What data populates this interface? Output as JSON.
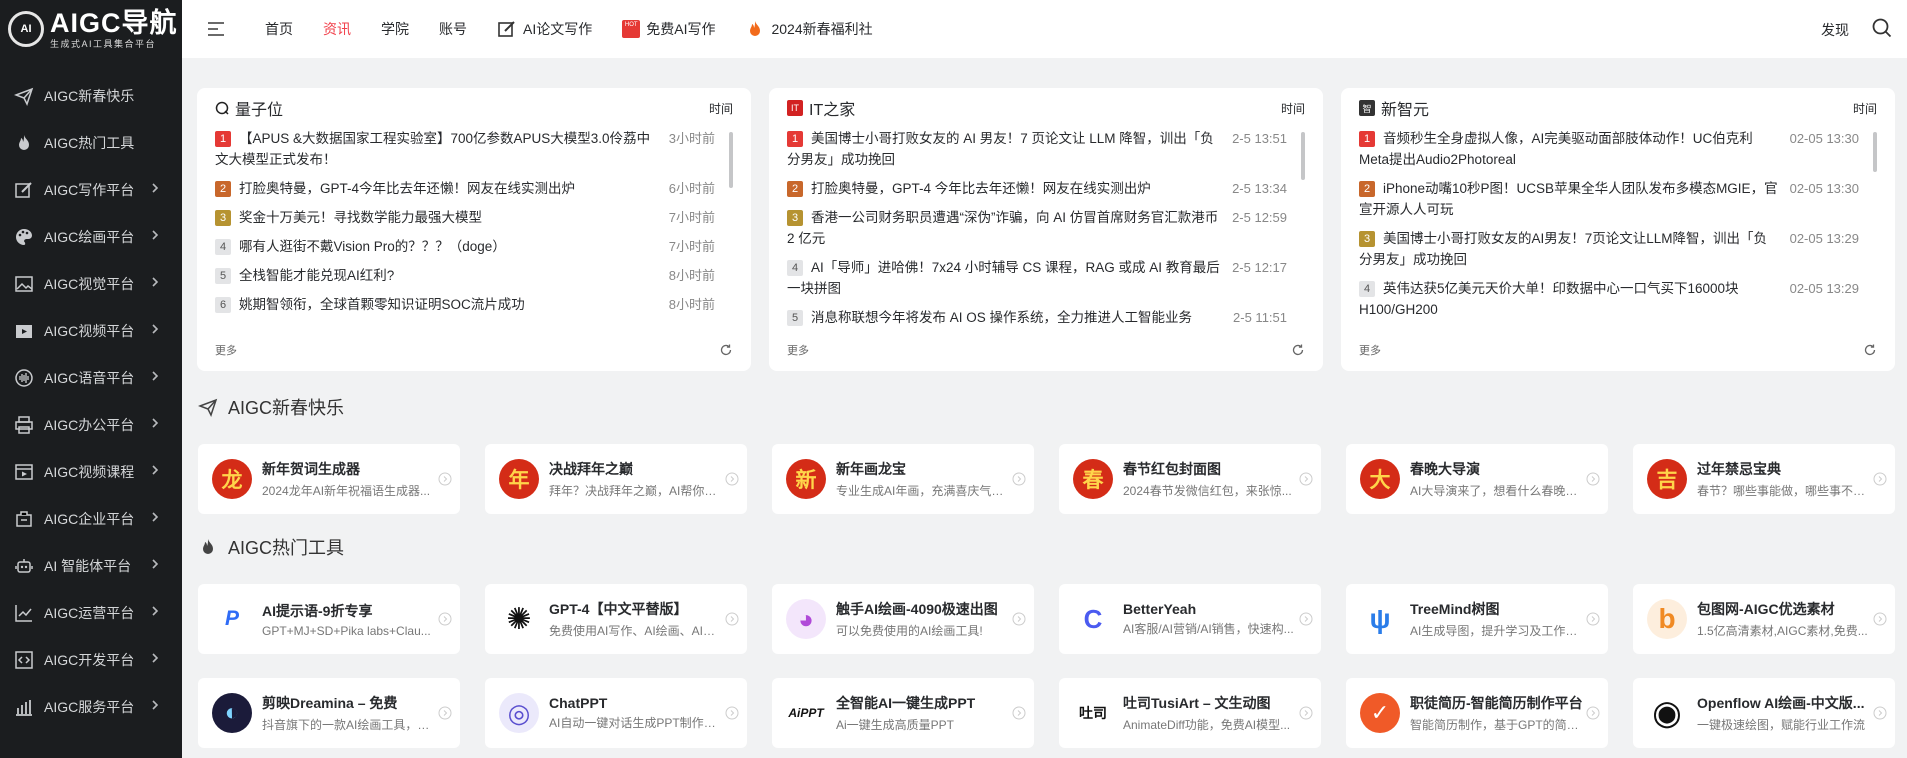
{
  "logo": {
    "title": "AIGC导航",
    "subtitle": "生成式AI工具集合平台",
    "mark": "AI"
  },
  "sidebar": {
    "items": [
      {
        "label": "AIGC新春快乐",
        "icon": "paper-plane-icon",
        "has_children": false
      },
      {
        "label": "AIGC热门工具",
        "icon": "fire-icon",
        "has_children": false
      },
      {
        "label": "AIGC写作平台",
        "icon": "pen-icon",
        "has_children": true
      },
      {
        "label": "AIGC绘画平台",
        "icon": "palette-icon",
        "has_children": true
      },
      {
        "label": "AIGC视觉平台",
        "icon": "image-icon",
        "has_children": true
      },
      {
        "label": "AIGC视频平台",
        "icon": "video-icon",
        "has_children": true
      },
      {
        "label": "AIGC语音平台",
        "icon": "waveform-icon",
        "has_children": true
      },
      {
        "label": "AIGC办公平台",
        "icon": "printer-icon",
        "has_children": true
      },
      {
        "label": "AIGC视频课程",
        "icon": "film-icon",
        "has_children": true
      },
      {
        "label": "AIGC企业平台",
        "icon": "building-icon",
        "has_children": true
      },
      {
        "label": "AI 智能体平台",
        "icon": "robot-icon",
        "has_children": true
      },
      {
        "label": "AIGC运营平台",
        "icon": "chart-line-icon",
        "has_children": true
      },
      {
        "label": "AIGC开发平台",
        "icon": "code-icon",
        "has_children": true
      },
      {
        "label": "AIGC服务平台",
        "icon": "bar-chart-icon",
        "has_children": true
      }
    ]
  },
  "topnav": {
    "items": [
      {
        "label": "首页",
        "active": false
      },
      {
        "label": "资讯",
        "active": true
      },
      {
        "label": "学院",
        "active": false
      },
      {
        "label": "账号",
        "active": false
      },
      {
        "label": "AI论文写作",
        "icon": "edit-icon",
        "active": false
      },
      {
        "label": "免费AI写作",
        "icon": "hot-icon",
        "badge": "HOT",
        "active": false
      },
      {
        "label": "2024新春福利社",
        "icon": "fire-icon",
        "active": false
      }
    ],
    "discover": "发现"
  },
  "news": [
    {
      "source": "量子位",
      "icon": "qbitai-icon",
      "icon_color": "#222222",
      "time_label": "时间",
      "more": "更多",
      "items": [
        {
          "rank": "1",
          "title": "【APUS &大数据国家工程实验室】700亿参数APUS大模型3.0伶荔中文大模型正式发布！",
          "time": "3小时前"
        },
        {
          "rank": "2",
          "title": "打脸奥特曼，GPT-4今年比去年还懒！网友在线实测出炉",
          "time": "6小时前"
        },
        {
          "rank": "3",
          "title": "奖金十万美元！寻找数学能力最强大模型",
          "time": "7小时前"
        },
        {
          "rank": "4",
          "title": "哪有人逛街不戴Vision Pro的？？？（doge）",
          "time": "7小时前"
        },
        {
          "rank": "5",
          "title": "全栈智能才能兑现AI红利?",
          "time": "8小时前"
        },
        {
          "rank": "6",
          "title": "姚期智领衔，全球首颗零知识证明SOC流片成功",
          "time": "8小时前"
        }
      ]
    },
    {
      "source": "IT之家",
      "icon": "ithome-icon",
      "icon_color": "#d22222",
      "time_label": "时间",
      "more": "更多",
      "items": [
        {
          "rank": "1",
          "title": "美国博士小哥打败女友的 AI 男友！7 页论文让 LLM 降智，训出「负分男友」成功挽回",
          "time": "2-5 13:51"
        },
        {
          "rank": "2",
          "title": "打脸奥特曼，GPT-4 今年比去年还懒！网友在线实测出炉",
          "time": "2-5 13:34"
        },
        {
          "rank": "3",
          "title": "香港一公司财务职员遭遇“深伪”诈骗，向 AI 仿冒首席财务官汇款港币 2 亿元",
          "time": "2-5 12:59"
        },
        {
          "rank": "4",
          "title": "AI「导师」进哈佛！7x24 小时辅导 CS 课程，RAG 或成 AI 教育最后一块拼图",
          "time": "2-5 12:17"
        },
        {
          "rank": "5",
          "title": "消息称联想今年将发布 AI OS 操作系统，全力推进人工智能业务",
          "time": "2-5 11:51"
        }
      ]
    },
    {
      "source": "新智元",
      "icon": "aiera-icon",
      "icon_color": "#333333",
      "time_label": "时间",
      "more": "更多",
      "items": [
        {
          "rank": "1",
          "title": "音频秒生全身虚拟人像，AI完美驱动面部肢体动作！UC伯克利Meta提出Audio2Photoreal",
          "time": "02-05 13:30"
        },
        {
          "rank": "2",
          "title": "iPhone动嘴10秒P图！UCSB苹果全华人团队发布多模态MGIE，官宣开源人人可玩",
          "time": "02-05 13:30"
        },
        {
          "rank": "3",
          "title": "美国博士小哥打败女友的AI男友！7页论文让LLM降智，训出「负分男友」成功挽回",
          "time": "02-05 13:29"
        },
        {
          "rank": "4",
          "title": "英伟达获5亿美元天价大单！印数据中心一口气买下16000块H100/GH200",
          "time": "02-05 13:29"
        }
      ]
    }
  ],
  "sections": [
    {
      "title": "AIGC新春快乐",
      "icon": "paper-plane-icon",
      "tools": [
        {
          "name": "新年贺词生成器",
          "desc": "2024龙年AI新年祝福语生成器...",
          "glyph": "龙",
          "style": "fest"
        },
        {
          "name": "决战拜年之巅",
          "desc": "拜年？决战拜年之巅，AI帮你提...",
          "glyph": "年",
          "style": "fest"
        },
        {
          "name": "新年画龙宝",
          "desc": "专业生成AI年画，充满喜庆气氛...",
          "glyph": "新",
          "style": "fest"
        },
        {
          "name": "春节红包封面图",
          "desc": "2024春节发微信红包，来张惊...",
          "glyph": "春",
          "style": "fest"
        },
        {
          "name": "春晚大导演",
          "desc": "AI大导演来了，想看什么春晚？...",
          "glyph": "大",
          "style": "fest"
        },
        {
          "name": "过年禁忌宝典",
          "desc": "春节？哪些事能做，哪些事不能...",
          "glyph": "吉",
          "style": "fest"
        }
      ]
    },
    {
      "title": "AIGC热门工具",
      "icon": "fire-icon",
      "tools": [
        {
          "name": "AI提示语-9折专享",
          "desc": "GPT+MJ+SD+Pika labs+Clau...",
          "glyph": "P",
          "color": "#2f6cf6"
        },
        {
          "name": "GPT-4【中文平替版】",
          "desc": "免费使用AI写作、AI绘画、AI问...",
          "glyph": "✺",
          "color": "#111111"
        },
        {
          "name": "触手AI绘画-4090极速出图",
          "desc": "可以免费使用的AI绘画工具!",
          "glyph": "◕",
          "color": "#b04ad8"
        },
        {
          "name": "BetterYeah",
          "desc": "AI客服/AI营销/AI销售，快速构...",
          "glyph": "C",
          "color": "#4b5bf0"
        },
        {
          "name": "TreeMind树图",
          "desc": "AI生成导图，提升学习及工作效...",
          "glyph": "ψ",
          "color": "#2b7de9"
        },
        {
          "name": "包图网-AIGC优选素材",
          "desc": "1.5亿高清素材,AIGC素材,免费...",
          "glyph": "b",
          "color": "#f08a24"
        },
        {
          "name": "剪映Dreamina – 免费",
          "desc": "抖音旗下的一款AI绘画工具，能...",
          "glyph": "◐",
          "color": "#1b1b3a"
        },
        {
          "name": "ChatPPT",
          "desc": "AI自动一键对话生成PPT制作，...",
          "glyph": "◎",
          "color": "#5a4fcf"
        },
        {
          "name": "全智能AI一键生成PPT",
          "desc": "Ai一键生成高质量PPT",
          "glyph": "AiPPT",
          "color": "#ffffff"
        },
        {
          "name": "吐司TusiArt – 文生动图",
          "desc": "AnimateDiff功能，免费AI模型...",
          "glyph": "吐司",
          "color": "#ffffff"
        },
        {
          "name": "职徒简历-智能简历制作平台",
          "desc": "智能简历制作，基于GPT的简历...",
          "glyph": "✓",
          "color": "#f05a28"
        },
        {
          "name": "Openflow AI绘画-中文版...",
          "desc": "一键极速绘图，赋能行业工作流",
          "glyph": "◉",
          "color": "#111111"
        }
      ]
    }
  ]
}
